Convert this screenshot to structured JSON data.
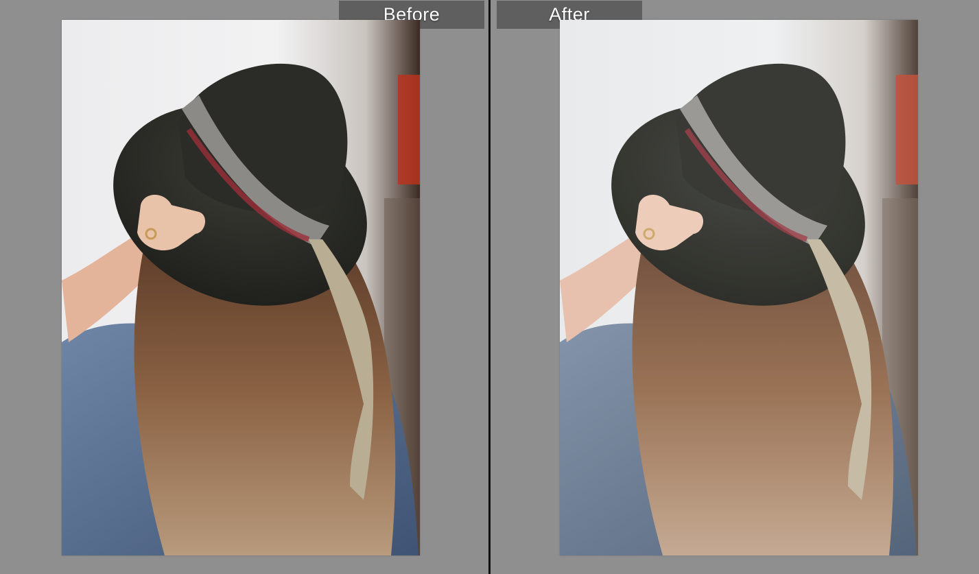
{
  "compare_view": {
    "before_label": "Before",
    "after_label": "After"
  },
  "colors": {
    "workspace_bg": "#8f8f8f",
    "label_bg": "#5f5f5f",
    "label_text": "#ffffff",
    "divider": "#111111"
  },
  "photo": {
    "subject_icon": "portrait-photo-icon"
  }
}
